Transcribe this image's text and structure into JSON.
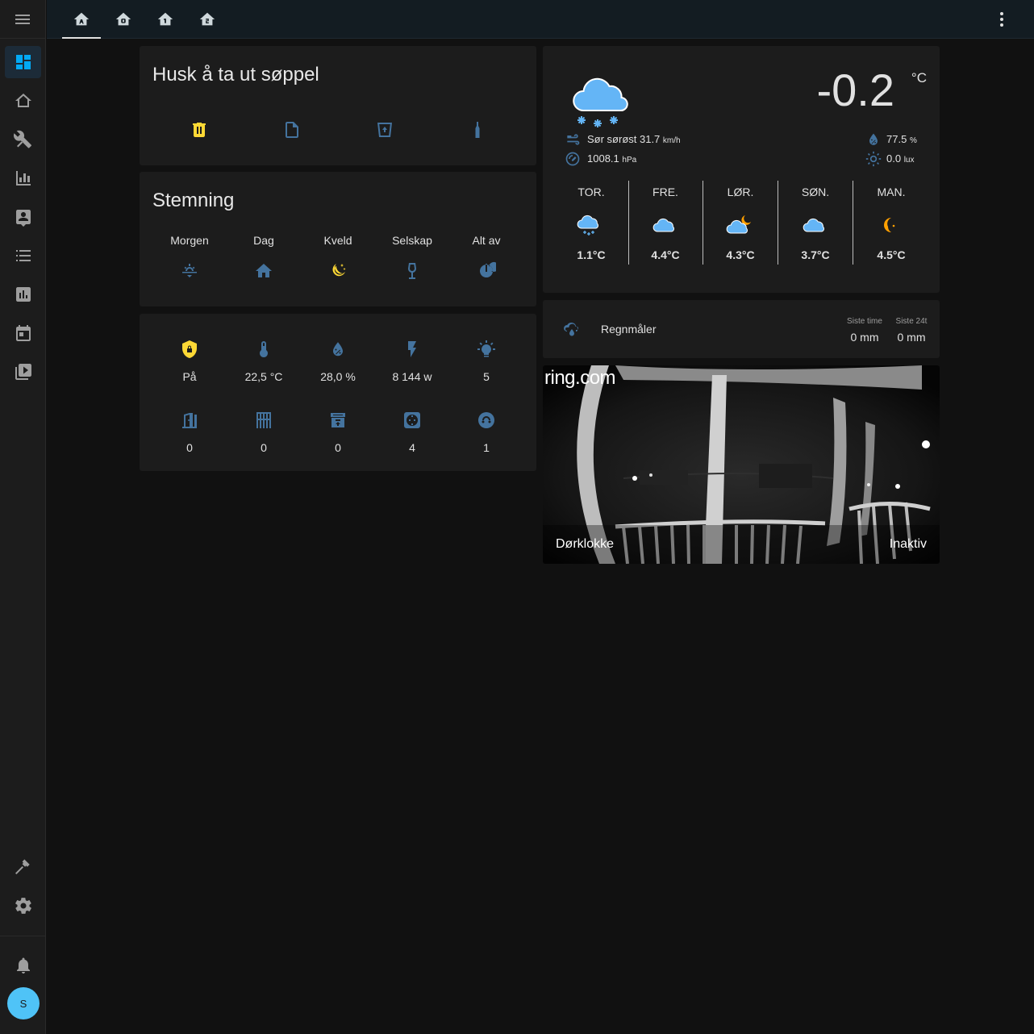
{
  "sidebar": {
    "menu_icon": "menu-icon",
    "items": [
      {
        "name": "overview",
        "icon": "dashboard-icon",
        "active": true
      },
      {
        "name": "home",
        "icon": "home-outline-icon"
      },
      {
        "name": "tools",
        "icon": "tools-icon"
      },
      {
        "name": "history",
        "icon": "chart-bar-icon"
      },
      {
        "name": "profile",
        "icon": "account-box-icon"
      },
      {
        "name": "logbook",
        "icon": "format-list-icon"
      },
      {
        "name": "energy",
        "icon": "chart-box-icon"
      },
      {
        "name": "calendar",
        "icon": "calendar-icon"
      },
      {
        "name": "media",
        "icon": "play-box-icon"
      }
    ],
    "developer_icon": "hammer-icon",
    "settings_icon": "cog-icon",
    "notifications_icon": "bell-icon",
    "user_initial": "S"
  },
  "tabs": [
    {
      "name": "home-floor-a",
      "active": true
    },
    {
      "name": "home-floor-0"
    },
    {
      "name": "home-floor-1"
    },
    {
      "name": "home-floor-2"
    }
  ],
  "trash": {
    "title": "Husk å ta ut søppel",
    "icons": [
      {
        "name": "trash-can-icon",
        "color": "#fdd835"
      },
      {
        "name": "paper-icon",
        "color": "#44739e"
      },
      {
        "name": "recycle-bin-icon",
        "color": "#44739e"
      },
      {
        "name": "bottle-icon",
        "color": "#44739e"
      }
    ]
  },
  "scenes": {
    "title": "Stemning",
    "items": [
      {
        "label": "Morgen",
        "icon": "sunrise-icon",
        "color": "#44739e"
      },
      {
        "label": "Dag",
        "icon": "home-icon",
        "color": "#44739e"
      },
      {
        "label": "Kveld",
        "icon": "moon-stars-icon",
        "color": "#fdd835"
      },
      {
        "label": "Selskap",
        "icon": "glass-wine-icon",
        "color": "#44739e"
      },
      {
        "label": "Alt av",
        "icon": "power-icon",
        "color": "#44739e"
      }
    ]
  },
  "status": {
    "row1": [
      {
        "value": "På",
        "icon": "shield-lock-icon",
        "color": "#fdd835"
      },
      {
        "value": "22,5 °C",
        "icon": "thermometer-icon",
        "color": "#44739e"
      },
      {
        "value": "28,0 %",
        "icon": "water-percent-icon",
        "color": "#44739e"
      },
      {
        "value": "8 144 w",
        "icon": "flash-icon",
        "color": "#44739e"
      },
      {
        "value": "5",
        "icon": "lightbulb-on-icon",
        "color": "#44739e"
      }
    ],
    "row2": [
      {
        "value": "0",
        "icon": "door-open-icon",
        "color": "#44739e"
      },
      {
        "value": "0",
        "icon": "window-icon",
        "color": "#44739e"
      },
      {
        "value": "0",
        "icon": "archive-icon",
        "color": "#44739e"
      },
      {
        "value": "4",
        "icon": "power-socket-icon",
        "color": "#44739e"
      },
      {
        "value": "1",
        "icon": "speaker-icon",
        "color": "#44739e"
      }
    ]
  },
  "weather": {
    "condition_icon": "snowy-cloud-icon",
    "temperature": "-0.2",
    "temp_unit": "°C",
    "wind": "Sør sørøst 31.7",
    "wind_unit": "km/h",
    "pressure": "1008.1",
    "pressure_unit": "hPa",
    "humidity": "77.5",
    "humidity_unit": "%",
    "illuminance": "0.0",
    "illuminance_unit": "lux",
    "forecast": [
      {
        "day": "TOR.",
        "temp": "1.1°C",
        "icon": "snowy-cloud-icon"
      },
      {
        "day": "FRE.",
        "temp": "4.4°C",
        "icon": "cloudy-icon"
      },
      {
        "day": "LØR.",
        "temp": "4.3°C",
        "icon": "partly-cloudy-night-icon"
      },
      {
        "day": "SØN.",
        "temp": "3.7°C",
        "icon": "cloudy-icon"
      },
      {
        "day": "MAN.",
        "temp": "4.5°C",
        "icon": "moon-icon"
      }
    ]
  },
  "rain": {
    "title": "Regnmåler",
    "icon": "weather-pouring-icon",
    "col1_label": "Siste time",
    "col1_value": "0 mm",
    "col2_label": "Siste 24t",
    "col2_value": "0 mm"
  },
  "camera": {
    "logo": "ring.com",
    "name": "Dørklokke",
    "state": "Inaktiv"
  }
}
